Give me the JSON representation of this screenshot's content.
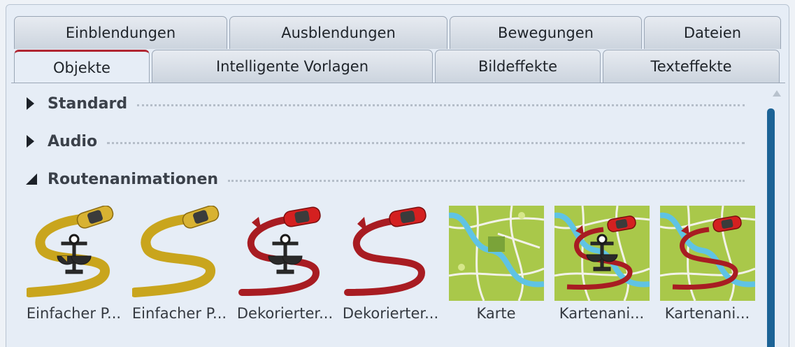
{
  "tabs_row1": [
    {
      "label": "Einblendungen"
    },
    {
      "label": "Ausblendungen"
    },
    {
      "label": "Bewegungen"
    },
    {
      "label": "Dateien"
    }
  ],
  "tabs_row2": [
    {
      "label": "Objekte",
      "active": true
    },
    {
      "label": "Intelligente Vorlagen"
    },
    {
      "label": "Bildeffekte"
    },
    {
      "label": "Texteffekte"
    }
  ],
  "sections": [
    {
      "title": "Standard",
      "expanded": false
    },
    {
      "title": "Audio",
      "expanded": false
    },
    {
      "title": "Routenanimationen",
      "expanded": true
    }
  ],
  "items": [
    {
      "label": "Einfacher P...",
      "icon": "yellow-route-car-scale-icon"
    },
    {
      "label": "Einfacher P...",
      "icon": "yellow-route-car-icon"
    },
    {
      "label": "Dekorierter...",
      "icon": "red-arrow-car-scale-icon"
    },
    {
      "label": "Dekorierter...",
      "icon": "red-arrow-car-icon"
    },
    {
      "label": "Karte",
      "icon": "map-icon"
    },
    {
      "label": "Kartenani...",
      "icon": "map-route-scale-icon"
    },
    {
      "label": "Kartenani...",
      "icon": "map-route-icon"
    }
  ],
  "colors": {
    "accent_tab": "#b02632",
    "scrollbar": "#1c6396",
    "route_yellow": "#c9a51d",
    "route_red": "#a81c22",
    "map_green": "#a9c84a",
    "map_water": "#5fc3e4"
  }
}
